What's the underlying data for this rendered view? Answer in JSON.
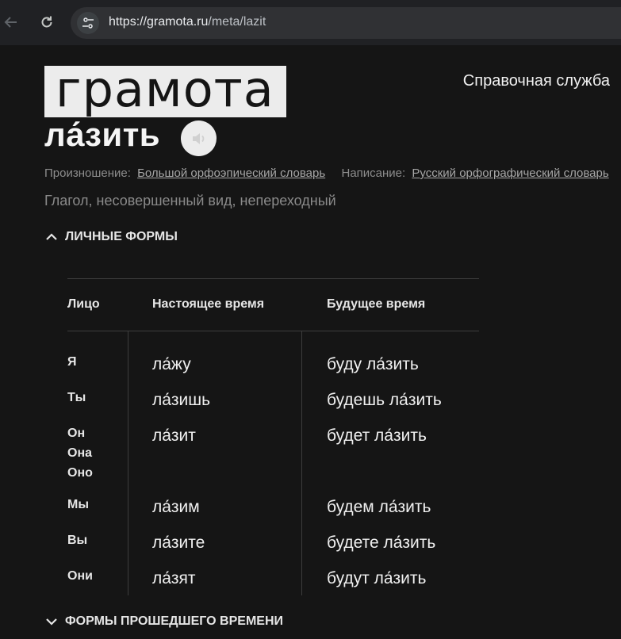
{
  "browser": {
    "url_host": "https://gramota.ru",
    "url_path": "/meta/lazit"
  },
  "header": {
    "logo_text": "грамота",
    "help_link": "Справочная служба"
  },
  "entry": {
    "headword": "ла́зить",
    "sources": {
      "pronunciation_label": "Произношение:",
      "pronunciation_link": "Большой орфоэпический словарь",
      "spelling_label": "Написание:",
      "spelling_link": "Русский орфографический словарь"
    },
    "grammar": "Глагол, несовершенный вид, непереходный"
  },
  "sections": {
    "personal_forms": "ЛИЧНЫЕ ФОРМЫ",
    "past_forms": "ФОРМЫ ПРОШЕДШЕГО ВРЕМЕНИ"
  },
  "table": {
    "headers": [
      "Лицо",
      "Настоящее время",
      "Будущее время"
    ],
    "rows": [
      {
        "person": "Я",
        "present": "ла́жу",
        "future": "буду ла́зить"
      },
      {
        "person": "Ты",
        "present": "ла́зишь",
        "future": "будешь ла́зить"
      },
      {
        "person": "Он\nОна\nОно",
        "present": "ла́зит",
        "future": "будет ла́зить"
      },
      {
        "person": "Мы",
        "present": "ла́зим",
        "future": "будем ла́зить"
      },
      {
        "person": "Вы",
        "present": "ла́зите",
        "future": "будете ла́зить"
      },
      {
        "person": "Они",
        "present": "ла́зят",
        "future": "будут ла́зить"
      }
    ]
  },
  "icons": {
    "back": "arrow-left-icon",
    "reload": "reload-icon",
    "site_info": "tune-icon",
    "speaker": "speaker-icon",
    "collapse": "chevron-up-icon",
    "expand": "chevron-down-icon"
  }
}
